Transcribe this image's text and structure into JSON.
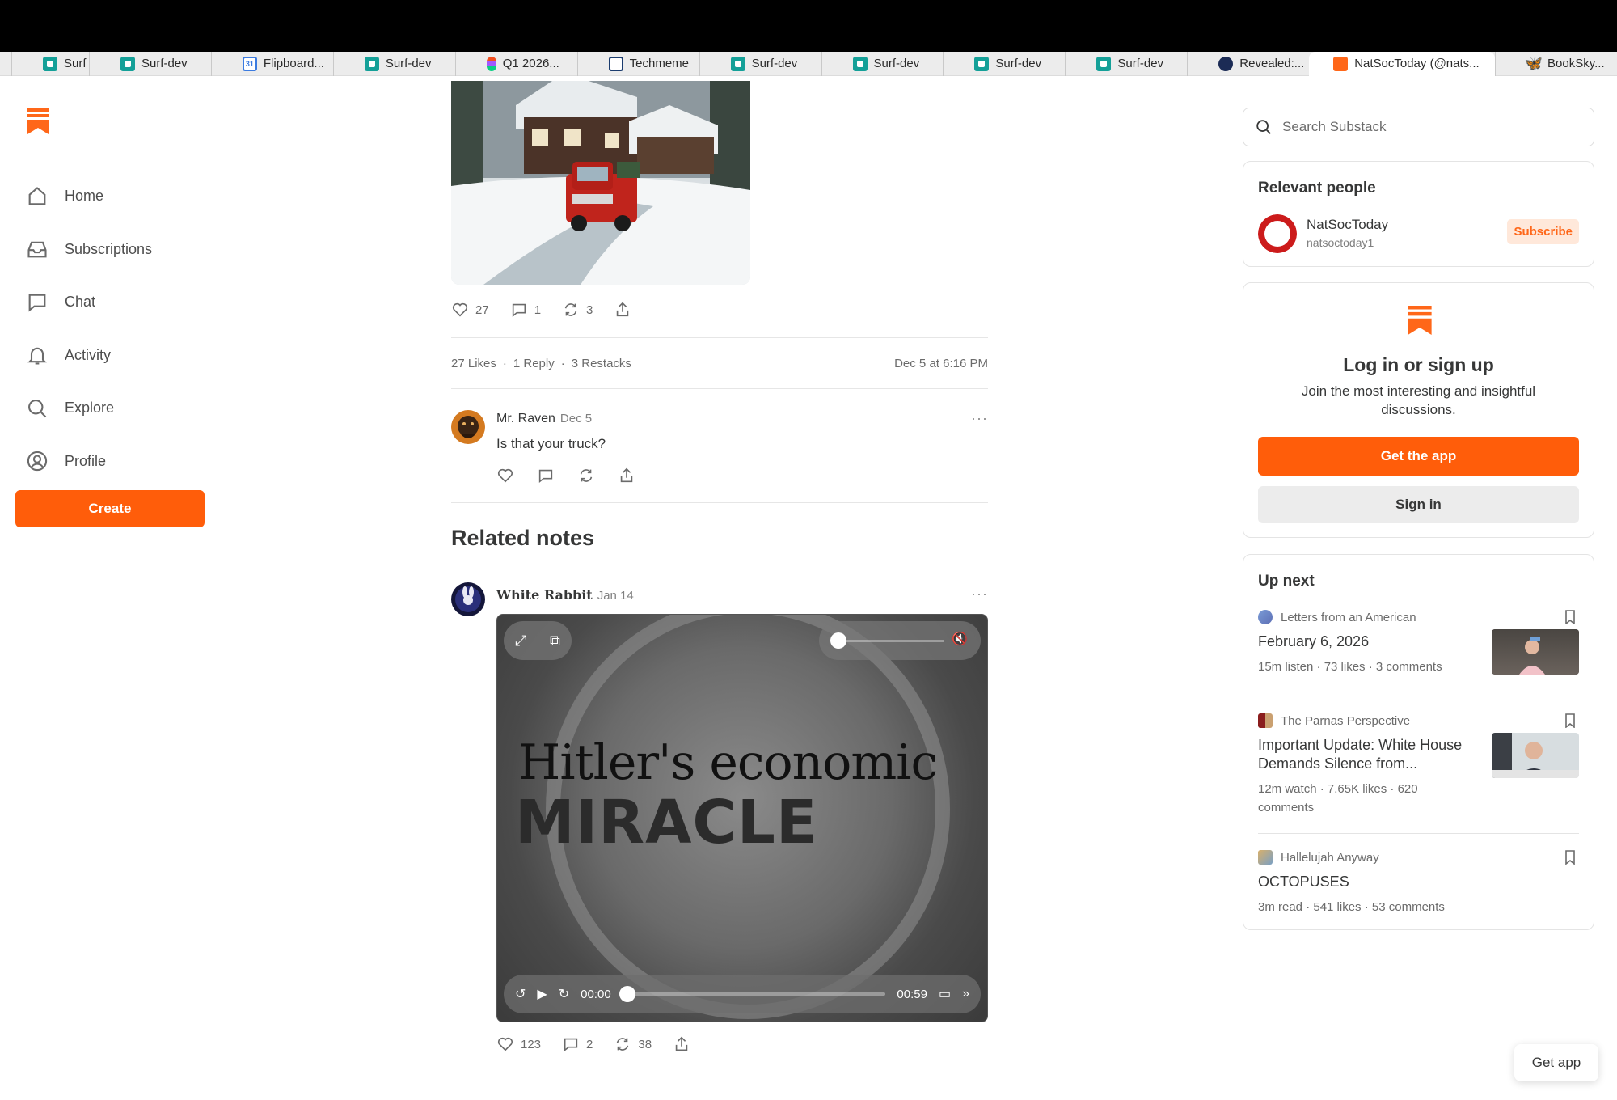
{
  "browser": {
    "tabs": [
      {
        "label": "Surf",
        "icon": "surf-icon"
      },
      {
        "label": "Surf-dev",
        "icon": "surf-icon"
      },
      {
        "label": "Flipboard...",
        "icon": "calendar-icon"
      },
      {
        "label": "Surf-dev",
        "icon": "surf-icon"
      },
      {
        "label": "Q1 2026...",
        "icon": "figma-icon"
      },
      {
        "label": "Techmeme",
        "icon": "techmeme-icon"
      },
      {
        "label": "Surf-dev",
        "icon": "surf-icon"
      },
      {
        "label": "Surf-dev",
        "icon": "surf-icon"
      },
      {
        "label": "Surf-dev",
        "icon": "surf-icon"
      },
      {
        "label": "Surf-dev",
        "icon": "surf-icon"
      },
      {
        "label": "Revealed:...",
        "icon": "revealed-icon"
      },
      {
        "label": "NatSocToday (@nats...",
        "icon": "substack-icon",
        "active": true
      },
      {
        "label": "BookSky...",
        "icon": "butterfly-icon"
      }
    ]
  },
  "sidebar": {
    "items": [
      {
        "label": "Home",
        "icon": "home-icon"
      },
      {
        "label": "Subscriptions",
        "icon": "inbox-icon"
      },
      {
        "label": "Chat",
        "icon": "chat-icon"
      },
      {
        "label": "Activity",
        "icon": "bell-icon"
      },
      {
        "label": "Explore",
        "icon": "search-icon"
      },
      {
        "label": "Profile",
        "icon": "profile-icon"
      }
    ],
    "create_label": "Create"
  },
  "post": {
    "likes": "27",
    "comments": "1",
    "restacks": "3",
    "likes_text": "27 Likes",
    "replies_text": "1 Reply",
    "restacks_text": "3 Restacks",
    "timestamp": "Dec 5 at 6:16 PM"
  },
  "comment": {
    "author": "Mr. Raven",
    "date": "Dec 5",
    "text": "Is that your truck?"
  },
  "related": {
    "title": "Related notes",
    "note": {
      "author": "White Rabbit",
      "date": "Jan 14",
      "video_text_line1": "Hitler's economic",
      "video_text_line2": "MIRACLE",
      "time_current": "00:00",
      "time_total": "00:59",
      "likes": "123",
      "comments": "2",
      "restacks": "38"
    }
  },
  "right": {
    "search_placeholder": "Search Substack",
    "relevant_people": {
      "title": "Relevant people",
      "name": "NatSocToday",
      "handle": "natsoctoday1",
      "subscribe_label": "Subscribe"
    },
    "login": {
      "title": "Log in or sign up",
      "description": "Join the most interesting and insightful discussions.",
      "get_app": "Get the app",
      "sign_in": "Sign in"
    },
    "up_next": {
      "title": "Up next",
      "items": [
        {
          "publication": "Letters from an American",
          "title": "February 6, 2026",
          "meta": "15m listen · 73 likes · 3 comments"
        },
        {
          "publication": "The Parnas Perspective",
          "title": "Important Update: White House Demands Silence from...",
          "meta": "12m watch · 7.65K likes · 620 comments"
        },
        {
          "publication": "Hallelujah Anyway",
          "title": "OCTOPUSES",
          "meta": "3m read · 541 likes · 53 comments"
        }
      ]
    }
  },
  "floating": {
    "get_app": "Get app"
  },
  "colors": {
    "accent": "#ff5d0a",
    "text": "#363737",
    "muted": "#6b6b6b"
  }
}
